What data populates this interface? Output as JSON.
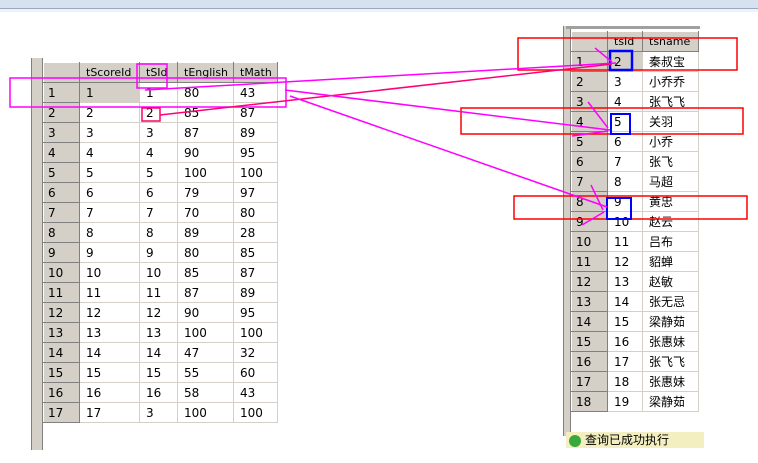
{
  "score_table": {
    "columns": [
      "tScoreId",
      "tSId",
      "tEnglish",
      "tMath"
    ],
    "rows": [
      [
        "1",
        "1",
        "1",
        "80",
        "43"
      ],
      [
        "2",
        "2",
        "2",
        "85",
        "87"
      ],
      [
        "3",
        "3",
        "3",
        "87",
        "89"
      ],
      [
        "4",
        "4",
        "4",
        "90",
        "95"
      ],
      [
        "5",
        "5",
        "5",
        "100",
        "100"
      ],
      [
        "6",
        "6",
        "6",
        "79",
        "97"
      ],
      [
        "7",
        "7",
        "7",
        "70",
        "80"
      ],
      [
        "8",
        "8",
        "8",
        "89",
        "28"
      ],
      [
        "9",
        "9",
        "9",
        "80",
        "85"
      ],
      [
        "10",
        "10",
        "10",
        "85",
        "87"
      ],
      [
        "11",
        "11",
        "11",
        "87",
        "89"
      ],
      [
        "12",
        "12",
        "12",
        "90",
        "95"
      ],
      [
        "13",
        "13",
        "13",
        "100",
        "100"
      ],
      [
        "14",
        "14",
        "14",
        "47",
        "32"
      ],
      [
        "15",
        "15",
        "15",
        "55",
        "60"
      ],
      [
        "16",
        "16",
        "16",
        "58",
        "43"
      ],
      [
        "17",
        "17",
        "3",
        "100",
        "100"
      ]
    ]
  },
  "student_table": {
    "columns": [
      "tsId",
      "tsname"
    ],
    "rows": [
      [
        "1",
        "2",
        "秦叔宝"
      ],
      [
        "2",
        "3",
        "小乔乔"
      ],
      [
        "3",
        "4",
        "张飞飞"
      ],
      [
        "4",
        "5",
        "关羽"
      ],
      [
        "5",
        "6",
        "小乔"
      ],
      [
        "6",
        "7",
        "张飞"
      ],
      [
        "7",
        "8",
        "马超"
      ],
      [
        "8",
        "9",
        "黄忠"
      ],
      [
        "9",
        "10",
        "赵云"
      ],
      [
        "10",
        "11",
        "吕布"
      ],
      [
        "11",
        "12",
        "貂蝉"
      ],
      [
        "12",
        "13",
        "赵敏"
      ],
      [
        "13",
        "14",
        "张无忌"
      ],
      [
        "14",
        "15",
        "梁静茹"
      ],
      [
        "15",
        "16",
        "张惠妹"
      ],
      [
        "16",
        "17",
        "张飞飞"
      ],
      [
        "17",
        "18",
        "张惠妹"
      ],
      [
        "18",
        "19",
        "梁静茹"
      ]
    ]
  },
  "status": {
    "text": "查询已成功执行",
    "icon": "success-icon"
  },
  "colors": {
    "magenta": "#ff00ff",
    "red": "#ff0000",
    "blue": "#0000ff"
  }
}
